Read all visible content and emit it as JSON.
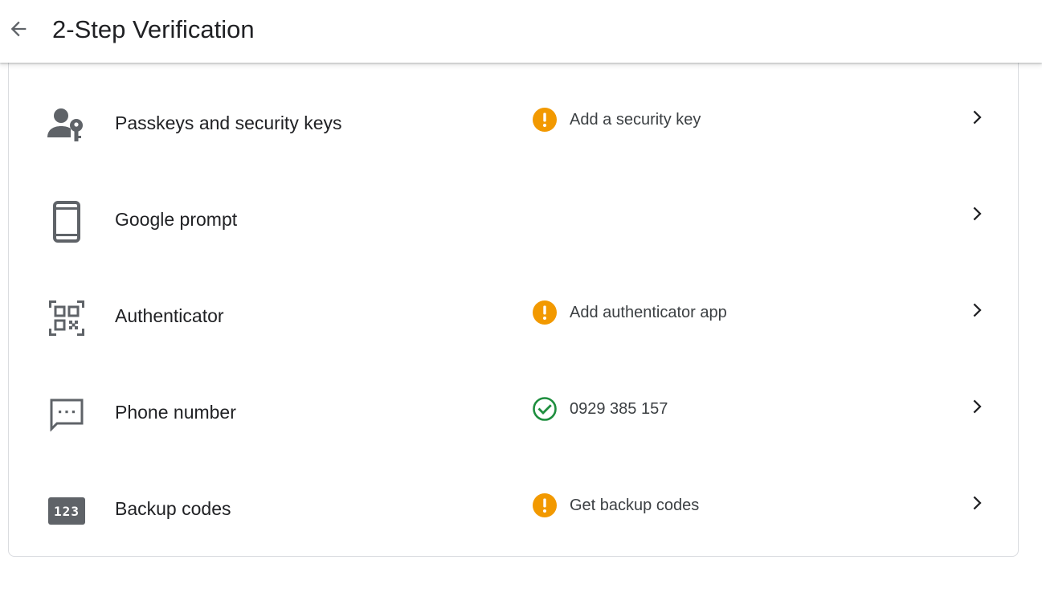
{
  "header": {
    "title": "2-Step Verification",
    "back_icon": "arrow-back-icon"
  },
  "colors": {
    "warning": "#F29900",
    "success": "#1E8E3E",
    "icon_gray": "#5F6368",
    "text": "#202124"
  },
  "rows": [
    {
      "label": "Passkeys and security keys",
      "icon": "passkey-icon",
      "status_icon": "warning-icon",
      "status_text": "Add a security key"
    },
    {
      "label": "Google prompt",
      "icon": "phone-device-icon",
      "status_icon": "",
      "status_text": ""
    },
    {
      "label": "Authenticator",
      "icon": "qr-code-icon",
      "status_icon": "warning-icon",
      "status_text": "Add authenticator app"
    },
    {
      "label": "Phone number",
      "icon": "sms-message-icon",
      "status_icon": "check-circle-icon",
      "status_text": "0929 385 157"
    },
    {
      "label": "Backup codes",
      "icon": "numbers-123-icon",
      "icon_text": "123",
      "status_icon": "warning-icon",
      "status_text": "Get backup codes"
    }
  ]
}
